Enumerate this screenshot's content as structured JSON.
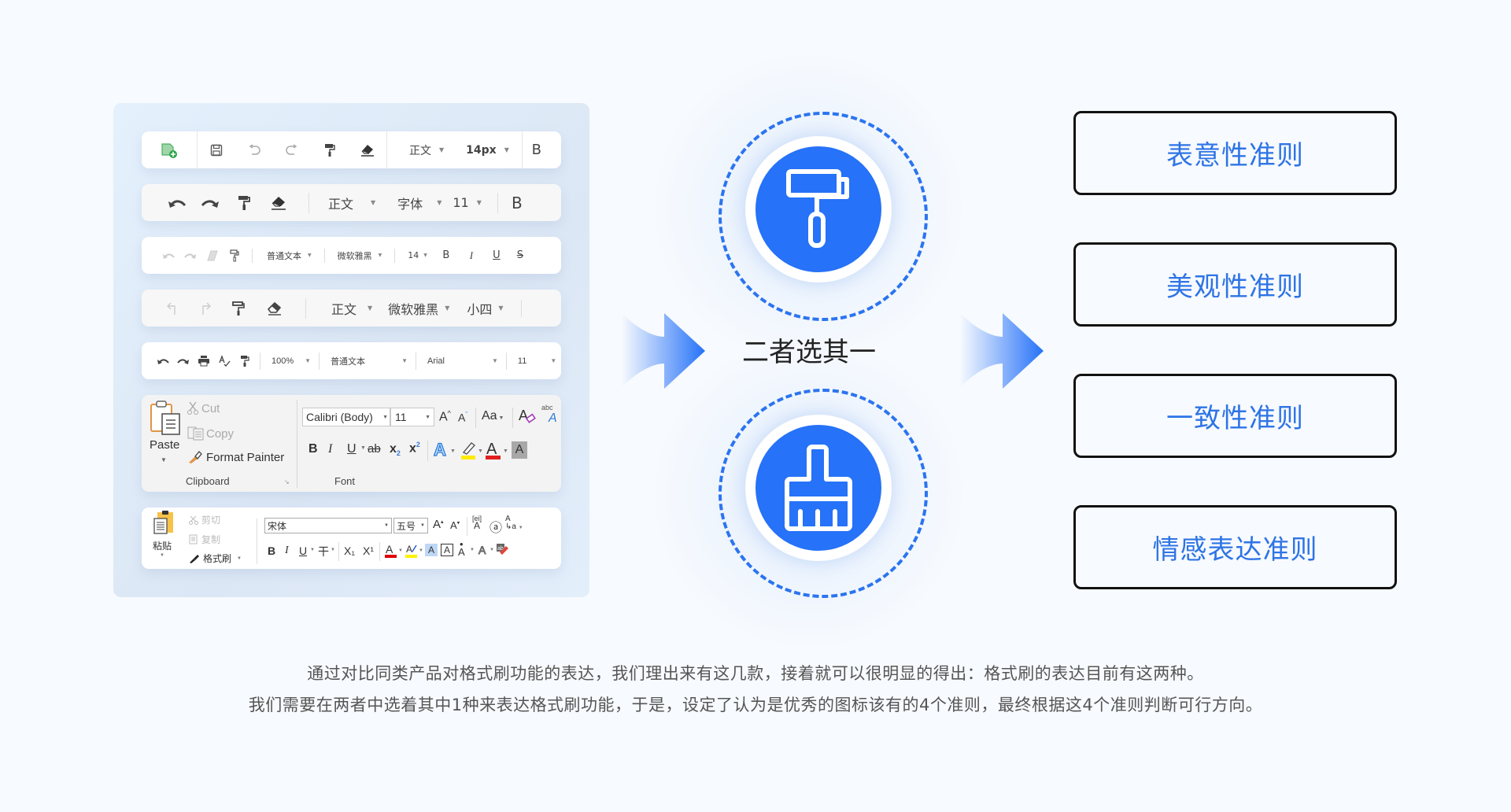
{
  "colors": {
    "background": "#F7FAFE",
    "accent_blue": "#2672F8",
    "criterion_text": "#2E74E6",
    "description_text": "#555555"
  },
  "toolbars": {
    "t1": {
      "icons": [
        "new-doc-icon",
        "save-icon",
        "undo-icon",
        "redo-icon",
        "format-painter-icon",
        "eraser-icon"
      ],
      "style": "正文",
      "size": "14px",
      "bold": "B"
    },
    "t2": {
      "icons": [
        "undo-icon",
        "redo-icon",
        "format-painter-icon",
        "eraser-icon"
      ],
      "style": "正文",
      "font": "字体",
      "size": "11",
      "bold": "B"
    },
    "t3": {
      "icons": [
        "undo-icon",
        "redo-icon",
        "eraser-icon",
        "format-painter-icon"
      ],
      "style": "普通文本",
      "font": "微软雅黑",
      "size": "14",
      "bold": "B",
      "italic": "I",
      "underline": "U",
      "strike": "S"
    },
    "t4": {
      "icons": [
        "undo-icon",
        "redo-icon",
        "format-painter-icon",
        "eraser-icon"
      ],
      "style": "正文",
      "font": "微软雅黑",
      "size": "小四"
    },
    "t5": {
      "icons": [
        "undo-icon",
        "redo-icon",
        "print-icon",
        "spellcheck-icon",
        "format-painter-icon"
      ],
      "zoom": "100%",
      "style": "普通文本",
      "font": "Arial",
      "size": "11"
    }
  },
  "ribbon": {
    "paste": "Paste",
    "cut": "Cut",
    "copy": "Copy",
    "format_painter": "Format Painter",
    "clipboard_group": "Clipboard",
    "font_name": "Calibri (Body)",
    "font_size": "11",
    "grow": "A",
    "shrink": "A",
    "change_case": "Aa",
    "bold": "B",
    "italic": "I",
    "underline": "U",
    "strike": "ab",
    "subscript": "x",
    "superscript": "x",
    "font_group": "Font"
  },
  "wps": {
    "paste": "粘贴",
    "cut": "剪切",
    "copy": "复制",
    "format_painter": "格式刷",
    "font_name": "宋体",
    "font_size": "五号",
    "bold": "B",
    "italic": "I",
    "underline": "U",
    "strike": "干",
    "subscript": "X₁",
    "superscript": "X¹"
  },
  "choose_label": "二者选其一",
  "options": [
    {
      "icon": "paint-roller-icon"
    },
    {
      "icon": "paint-brush-icon"
    }
  ],
  "criteria": [
    "表意性准则",
    "美观性准则",
    "一致性准则",
    "情感表达准则"
  ],
  "description": {
    "line1": "通过对比同类产品对格式刷功能的表达，我们理出来有这几款，接着就可以很明显的得出：格式刷的表达目前有这两种。",
    "line2": "我们需要在两者中选着其中1种来表达格式刷功能，于是，设定了认为是优秀的图标该有的4个准则，最终根据这4个准则判断可行方向。"
  }
}
